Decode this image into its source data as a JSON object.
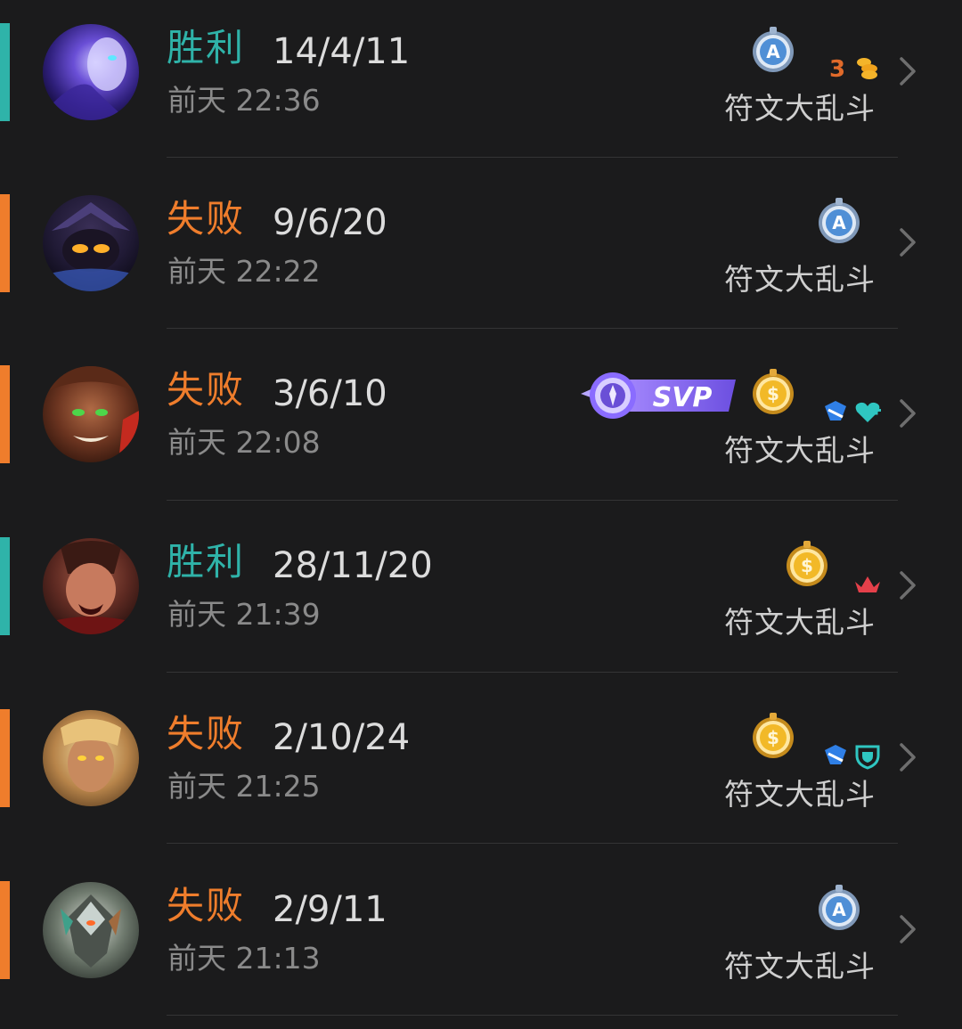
{
  "colors": {
    "win": "#2fb3a9",
    "loss": "#ef7d2c",
    "background": "#1b1b1c",
    "divider": "#343435",
    "secondary_text": "#8a8a8a"
  },
  "matches": [
    {
      "result": "胜利",
      "result_type": "win",
      "kda": "14/4/11",
      "time": "前天 22:36",
      "mode": "符文大乱斗",
      "medal": "silver-a-medal",
      "badges": [
        "triple-kill-icon",
        "gold-coins-icon"
      ],
      "badge_text": "3",
      "avatar": "champion-avatar-purple-ghost"
    },
    {
      "result": "失败",
      "result_type": "loss",
      "kda": "9/6/20",
      "time": "前天 22:22",
      "mode": "符文大乱斗",
      "medal": "silver-a-medal",
      "badges": [],
      "avatar": "champion-avatar-dark-mage"
    },
    {
      "result": "失败",
      "result_type": "loss",
      "kda": "3/6/10",
      "time": "前天 22:08",
      "mode": "符文大乱斗",
      "medal": "gold-s-medal",
      "svp": "SVP",
      "badges": [
        "damage-taken-icon",
        "healing-icon"
      ],
      "avatar": "champion-avatar-monkey-king"
    },
    {
      "result": "胜利",
      "result_type": "win",
      "kda": "28/11/20",
      "time": "前天 21:39",
      "mode": "符文大乱斗",
      "medal": "gold-s-medal",
      "badges": [
        "crown-icon"
      ],
      "avatar": "champion-avatar-warrior"
    },
    {
      "result": "失败",
      "result_type": "loss",
      "kda": "2/10/24",
      "time": "前天 21:25",
      "mode": "符文大乱斗",
      "medal": "gold-s-medal",
      "badges": [
        "damage-taken-icon",
        "shield-icon"
      ],
      "avatar": "champion-avatar-golden-woman"
    },
    {
      "result": "失败",
      "result_type": "loss",
      "kda": "2/9/11",
      "time": "前天 21:13",
      "mode": "符文大乱斗",
      "medal": "silver-a-medal",
      "badges": [],
      "avatar": "champion-avatar-armored-robot"
    }
  ]
}
